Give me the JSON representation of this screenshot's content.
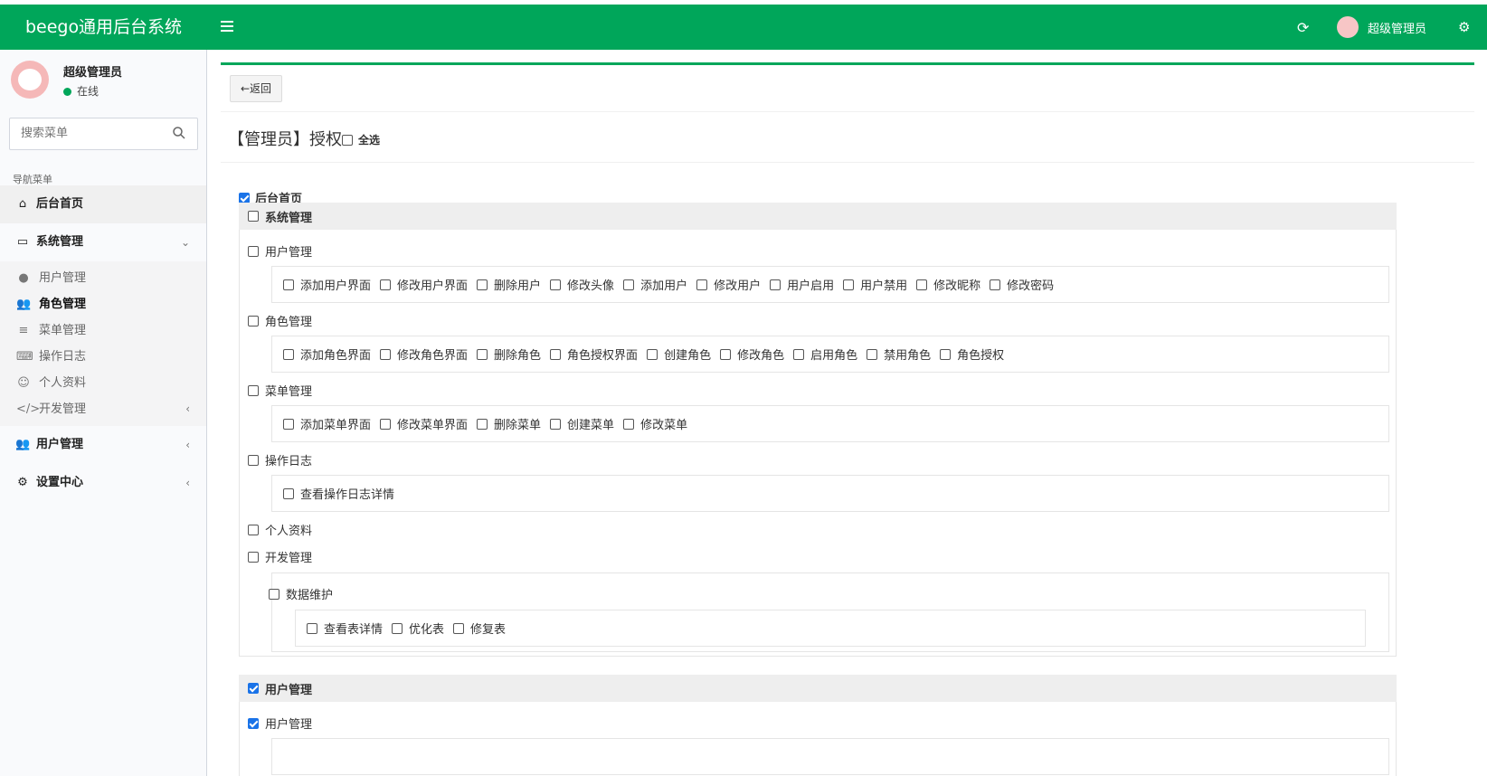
{
  "header": {
    "brand": "beego通用后台系统",
    "user_name": "超级管理员"
  },
  "sidebar": {
    "user_name": "超级管理员",
    "status": "在线",
    "search_placeholder": "搜索菜单",
    "nav_header": "导航菜单",
    "items": [
      {
        "label": "后台首页",
        "icon": "home-icon"
      },
      {
        "label": "系统管理",
        "icon": "monitor-icon",
        "sub": [
          {
            "label": "用户管理",
            "icon": "user-icon"
          },
          {
            "label": "角色管理",
            "icon": "users-icon"
          },
          {
            "label": "菜单管理",
            "icon": "list-icon"
          },
          {
            "label": "操作日志",
            "icon": "keyboard-icon"
          },
          {
            "label": "个人资料",
            "icon": "smile-icon"
          },
          {
            "label": "开发管理",
            "icon": "code-icon"
          }
        ]
      },
      {
        "label": "用户管理",
        "icon": "users-icon"
      },
      {
        "label": "设置中心",
        "icon": "cogs-icon"
      }
    ]
  },
  "main": {
    "back_label": "返回",
    "title": "【管理员】授权",
    "select_all": "全选",
    "home": "后台首页",
    "system_group": "系统管理",
    "user_mgmt": "用户管理",
    "user_items": [
      "添加用户界面",
      "修改用户界面",
      "删除用户",
      "修改头像",
      "添加用户",
      "修改用户",
      "用户启用",
      "用户禁用",
      "修改昵称",
      "修改密码"
    ],
    "role_mgmt": "角色管理",
    "role_items": [
      "添加角色界面",
      "修改角色界面",
      "删除角色",
      "角色授权界面",
      "创建角色",
      "修改角色",
      "启用角色",
      "禁用角色",
      "角色授权"
    ],
    "menu_mgmt": "菜单管理",
    "menu_items": [
      "添加菜单界面",
      "修改菜单界面",
      "删除菜单",
      "创建菜单",
      "修改菜单"
    ],
    "log": "操作日志",
    "log_items": [
      "查看操作日志详情"
    ],
    "profile": "个人资料",
    "dev_mgmt": "开发管理",
    "data_maint": "数据维护",
    "data_items": [
      "查看表详情",
      "优化表",
      "修复表"
    ],
    "user_group": "用户管理",
    "user_group_child": "用户管理"
  },
  "colors": {
    "brand": "#00a65a",
    "checkbox_on": "#1a73e8"
  }
}
